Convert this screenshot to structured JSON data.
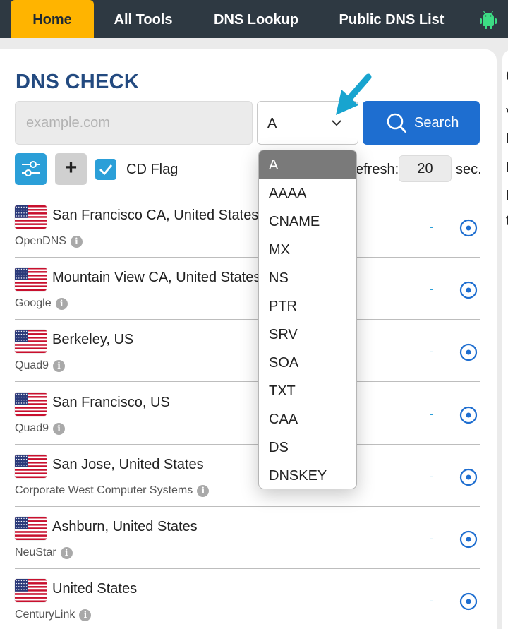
{
  "nav": {
    "tabs": [
      {
        "label": "Home",
        "active": true
      },
      {
        "label": "All Tools"
      },
      {
        "label": "DNS Lookup"
      },
      {
        "label": "Public DNS List"
      }
    ],
    "icon": "android-icon"
  },
  "side": {
    "chars": [
      "C",
      "V",
      "I",
      "I",
      "I",
      "t"
    ]
  },
  "title": "DNS CHECK",
  "search": {
    "placeholder": "example.com",
    "value": "",
    "record_type": "A",
    "button_label": "Search"
  },
  "controls": {
    "cd_flag_label": "CD Flag",
    "cd_flag_checked": true,
    "refresh_label": "efresh:",
    "refresh_value": "20",
    "sec_label": "sec."
  },
  "record_types": [
    "A",
    "AAAA",
    "CNAME",
    "MX",
    "NS",
    "PTR",
    "SRV",
    "SOA",
    "TXT",
    "CAA",
    "DS",
    "DNSKEY"
  ],
  "servers": [
    {
      "location": "San Francisco CA, United States",
      "provider": "OpenDNS",
      "result": "-"
    },
    {
      "location": "Mountain View CA, United States",
      "provider": "Google",
      "result": "-"
    },
    {
      "location": "Berkeley, US",
      "provider": "Quad9",
      "result": "-"
    },
    {
      "location": "San Francisco, US",
      "provider": "Quad9",
      "result": "-"
    },
    {
      "location": "San Jose, United States",
      "provider": "Corporate West Computer Systems",
      "result": "-"
    },
    {
      "location": "Ashburn, United States",
      "provider": "NeuStar",
      "result": "-"
    },
    {
      "location": "United States",
      "provider": "CenturyLink",
      "result": "-"
    }
  ],
  "colors": {
    "nav_bg": "#2e3942",
    "nav_active": "#ffb400",
    "title": "#234a80",
    "search_button": "#1e6ed0",
    "accent": "#2b9fd8",
    "arrow": "#18a4cf"
  }
}
